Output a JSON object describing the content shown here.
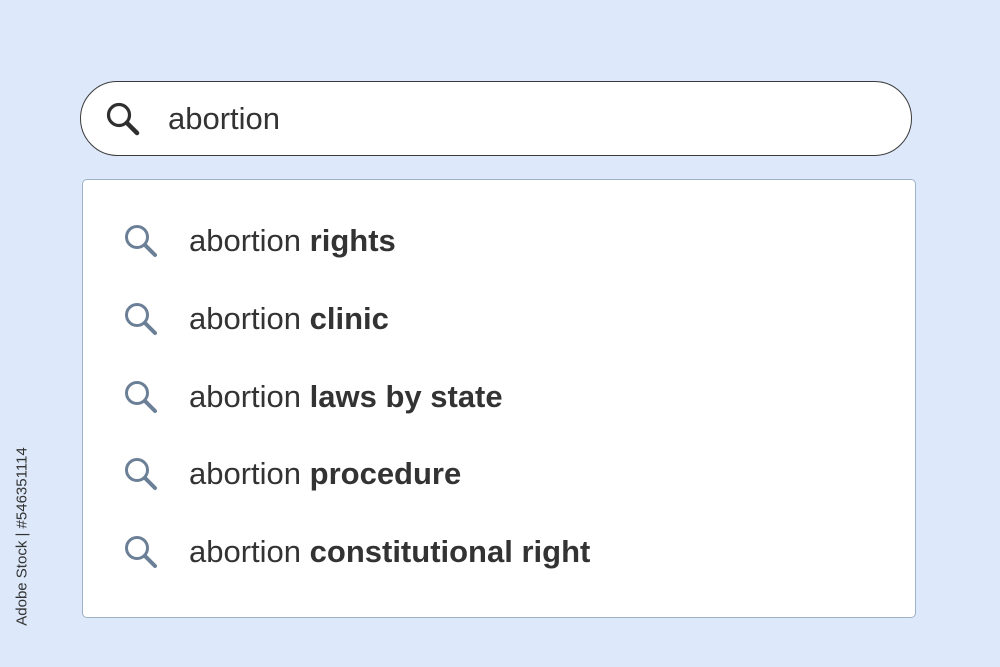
{
  "search": {
    "value": "abortion",
    "icon": "search-icon"
  },
  "suggestions": [
    {
      "prefix": "abortion ",
      "completion": "rights"
    },
    {
      "prefix": "abortion ",
      "completion": "clinic"
    },
    {
      "prefix": "abortion ",
      "completion": "laws by state"
    },
    {
      "prefix": "abortion ",
      "completion": "procedure"
    },
    {
      "prefix": "abortion ",
      "completion": "constitutional right"
    }
  ],
  "credit": "Adobe Stock | #546351114",
  "colors": {
    "background": "#dde9fa",
    "main_icon": "#2f2f2f",
    "suggestion_icon": "#6b7f96",
    "text": "#333333"
  }
}
